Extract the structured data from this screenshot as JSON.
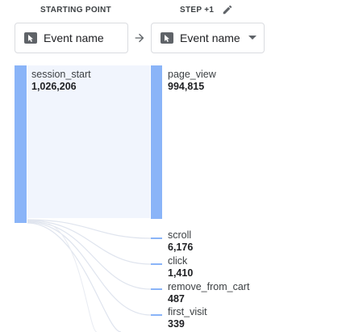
{
  "headers": {
    "starting_point": "STARTING POINT",
    "step": "STEP +1"
  },
  "selectors": {
    "start": {
      "label": "Event name",
      "icon": "cursor-icon"
    },
    "step": {
      "label": "Event name",
      "icon": "cursor-icon",
      "has_dropdown": true
    }
  },
  "icons": {
    "edit": "pencil-icon",
    "arrow": "arrow-right-icon"
  },
  "colors": {
    "node": "#8ab4f8",
    "flow": "#eef3fd",
    "link": "#dfe4ee"
  },
  "start_node": {
    "name": "session_start",
    "value": "1,026,206"
  },
  "step_nodes": [
    {
      "name": "page_view",
      "value": "994,815"
    },
    {
      "name": "scroll",
      "value": "6,176"
    },
    {
      "name": "click",
      "value": "1,410"
    },
    {
      "name": "remove_from_cart",
      "value": "487"
    },
    {
      "name": "first_visit",
      "value": "339"
    }
  ]
}
